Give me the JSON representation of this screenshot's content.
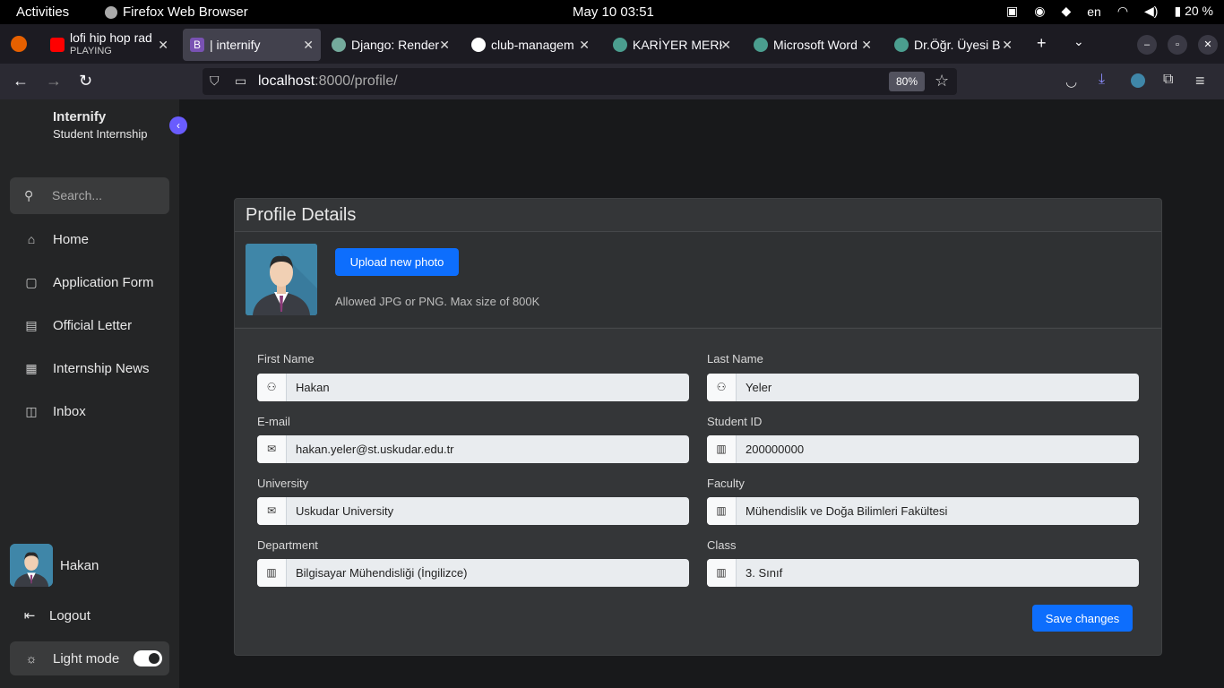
{
  "system": {
    "activities": "Activities",
    "app_name": "Firefox Web Browser",
    "clock": "May 10  03:51",
    "language": "en",
    "battery": "20 %"
  },
  "tabs": [
    {
      "title": "lofi hip hop rad",
      "subtitle": "PLAYING",
      "active": false
    },
    {
      "title": "| internify",
      "active": true
    },
    {
      "title": "Django: Render",
      "active": false
    },
    {
      "title": "club-managem",
      "active": false
    },
    {
      "title": "KARİYER MERK",
      "active": false
    },
    {
      "title": "Microsoft Word",
      "active": false
    },
    {
      "title": "Dr.Öğr. Üyesi B",
      "active": false
    }
  ],
  "url": {
    "host": "localhost",
    "rest": ":8000/profile/"
  },
  "zoom": "80%",
  "sidebar": {
    "brand_name": "Internify",
    "brand_sub": "Student Internship",
    "search_placeholder": "Search...",
    "items": [
      {
        "label": "Home",
        "icon": "home-icon"
      },
      {
        "label": "Application Form",
        "icon": "book-icon"
      },
      {
        "label": "Official Letter",
        "icon": "document-icon"
      },
      {
        "label": "Internship News",
        "icon": "news-icon"
      },
      {
        "label": "Inbox",
        "icon": "inbox-icon"
      }
    ],
    "user_name": "Hakan",
    "logout": "Logout",
    "light_mode": "Light mode"
  },
  "profile": {
    "title": "Profile Details",
    "upload_button": "Upload new photo",
    "allowed_text": "Allowed JPG or PNG. Max size of 800K",
    "fields": {
      "first_name": {
        "label": "First Name",
        "value": "Hakan"
      },
      "last_name": {
        "label": "Last Name",
        "value": "Yeler"
      },
      "email": {
        "label": "E-mail",
        "value": "hakan.yeler@st.uskudar.edu.tr"
      },
      "student_id": {
        "label": "Student ID",
        "value": "200000000"
      },
      "university": {
        "label": "University",
        "value": "Uskudar University"
      },
      "faculty": {
        "label": "Faculty",
        "value": "Mühendislik ve Doğa Bilimleri Fakültesi"
      },
      "department": {
        "label": "Department",
        "value": "Bilgisayar Mühendisliği (İngilizce)"
      },
      "class": {
        "label": "Class",
        "value": "3. Sınıf"
      }
    },
    "save_button": "Save changes"
  },
  "colors": {
    "accent": "#0d6efd",
    "sidebar_accent": "#695cfe"
  }
}
